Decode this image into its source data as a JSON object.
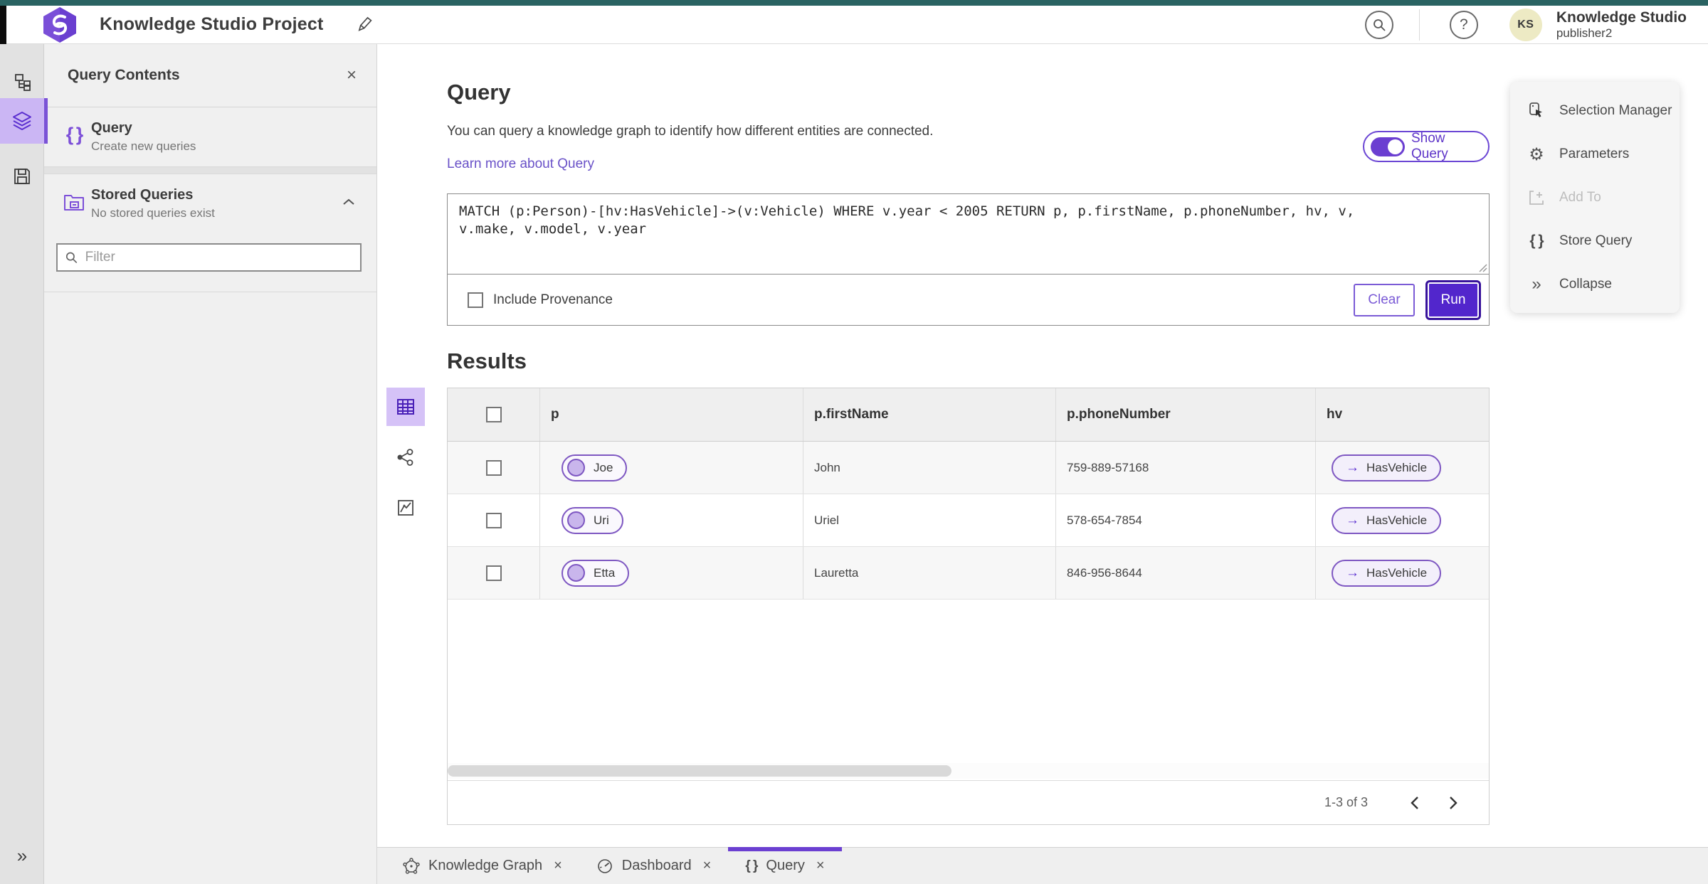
{
  "app": {
    "title": "Knowledge Studio Project",
    "product": "Knowledge Studio",
    "user": "publisher2",
    "avatar_initials": "KS"
  },
  "icons": {
    "help_glyph": "?",
    "close_glyph": "×",
    "collapse_glyph": "»",
    "expand_glyph": "»",
    "braces_glyph": "{ }",
    "gear_glyph": "⚙",
    "edge_arrow_glyph": "→"
  },
  "left_panel": {
    "header": "Query Contents",
    "query_item": {
      "title": "Query",
      "subtitle": "Create new queries"
    },
    "stored_item": {
      "title": "Stored Queries",
      "subtitle": "No stored queries exist"
    },
    "filter_placeholder": "Filter"
  },
  "main": {
    "heading": "Query",
    "description": "You can query a knowledge graph to identify how different entities are connected.",
    "link": "Learn more about Query",
    "show_query_label": "Show Query",
    "query_text": "MATCH (p:Person)-[hv:HasVehicle]->(v:Vehicle) WHERE v.year < 2005 RETURN p, p.firstName, p.phoneNumber, hv, v, v.make, v.model, v.year",
    "include_provenance_label": "Include Provenance",
    "clear_label": "Clear",
    "run_label": "Run",
    "results_heading": "Results"
  },
  "table": {
    "columns": [
      "p",
      "p.firstName",
      "p.phoneNumber",
      "hv"
    ],
    "rows": [
      {
        "p": "Joe",
        "firstName": "John",
        "phone": "759-889-57168",
        "hv": "HasVehicle"
      },
      {
        "p": "Uri",
        "firstName": "Uriel",
        "phone": "578-654-7854",
        "hv": "HasVehicle"
      },
      {
        "p": "Etta",
        "firstName": "Lauretta",
        "phone": "846-956-8644",
        "hv": "HasVehicle"
      }
    ],
    "pagination": {
      "range_label": "1-3 of 3"
    }
  },
  "right_menu": {
    "items": [
      {
        "label": "Selection Manager"
      },
      {
        "label": "Parameters"
      },
      {
        "label": "Add To"
      },
      {
        "label": "Store Query"
      },
      {
        "label": "Collapse"
      }
    ]
  },
  "tabs": [
    {
      "label": "Knowledge Graph"
    },
    {
      "label": "Dashboard"
    },
    {
      "label": "Query"
    }
  ],
  "colors": {
    "accent_purple": "#5226cc",
    "accent_light": "#cbb6f4",
    "pill_border": "#7e57c2",
    "link": "#6a52c8",
    "top_strip_teal": "#2a6362",
    "avatar_bg": "#edeac4"
  }
}
